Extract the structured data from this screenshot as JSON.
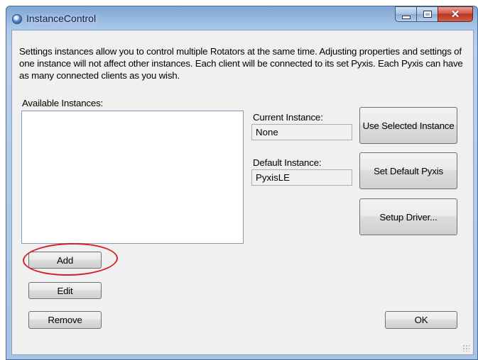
{
  "window": {
    "title": "InstanceControl"
  },
  "description": "Settings instances allow you to control multiple Rotators at the same time. Adjusting properties and settings of one instance will not affect other instances. Each client will be connected to its set Pyxis. Each Pyxis can have as many connected clients as you wish.",
  "available_instances": {
    "label": "Available Instances:",
    "items": []
  },
  "current_instance": {
    "label": "Current Instance:",
    "value": "None"
  },
  "default_instance": {
    "label": "Default Instance:",
    "value": "PyxisLE"
  },
  "buttons": {
    "use_selected": "Use Selected Instance",
    "set_default": "Set Default Pyxis",
    "setup_driver": "Setup Driver...",
    "add": "Add",
    "edit": "Edit",
    "remove": "Remove",
    "ok": "OK"
  },
  "colors": {
    "annotation": "#d9202a",
    "titlebar": "#a9c6e8"
  }
}
